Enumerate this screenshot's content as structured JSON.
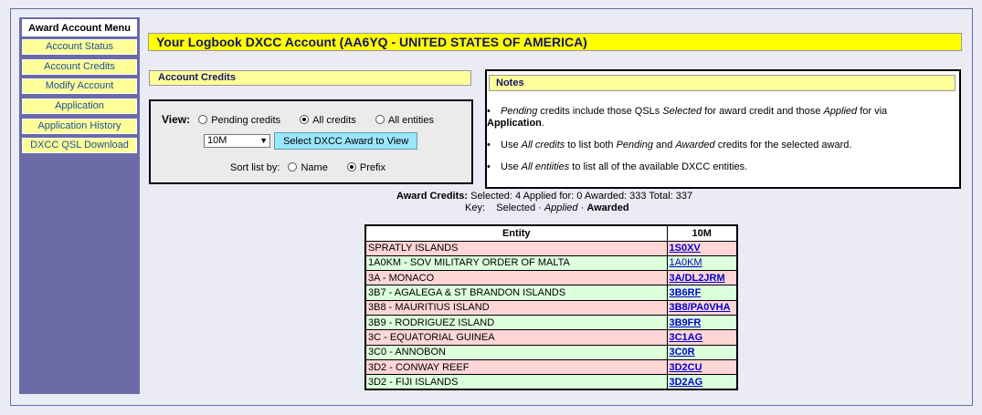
{
  "sidebar": {
    "header": "Award Account Menu",
    "items": [
      {
        "label": "Account Status"
      },
      {
        "label": "Account Credits"
      },
      {
        "label": "Modify Account"
      },
      {
        "label": "Application"
      },
      {
        "label": "Application History"
      },
      {
        "label": "DXCC QSL Download"
      }
    ]
  },
  "title": "Your Logbook DXCC Account (AA6YQ - UNITED STATES OF AMERICA)",
  "account_credits": {
    "header": "Account Credits",
    "view_label": "View:",
    "view_options": [
      "Pending credits",
      "All credits",
      "All entities"
    ],
    "view_selected": "All credits",
    "award_select_value": "10M",
    "select_button": "Select DXCC Award to View",
    "sort_label": "Sort list by:",
    "sort_options": [
      "Name",
      "Prefix"
    ],
    "sort_selected": "Prefix"
  },
  "notes": {
    "header": "Notes",
    "n1": {
      "a": "Pending",
      "b": " credits include those QSLs ",
      "c": "Selected",
      "d": " for award credit and those ",
      "e": "Applied",
      "f": " for via",
      "g": "Application",
      "h": "."
    },
    "n2": {
      "a": "Use ",
      "b": "All credits",
      "c": " to list both ",
      "d": "Pending",
      "e": " and ",
      "f": "Awarded",
      "g": " credits for the selected award."
    },
    "n3": {
      "a": "Use ",
      "b": "All entiities",
      "c": " to list all of the available DXCC entities."
    }
  },
  "summary": {
    "label": "Award Credits:",
    "text": " Selected: 4 Applied for: 0 Awarded: 333 Total: 337",
    "key_label": "Key:",
    "key_selected": "Selected",
    "sep": " · ",
    "key_applied": "Applied",
    "key_awarded": "Awarded"
  },
  "table": {
    "headers": [
      "Entity",
      "10M"
    ],
    "rows": [
      {
        "entity": "SPRATLY ISLANDS",
        "call": "1S0XV",
        "status": "pink"
      },
      {
        "entity": "1A0KM - SOV MILITARY ORDER OF MALTA",
        "call": "1A0KM",
        "status": "green"
      },
      {
        "entity": "3A - MONACO",
        "call": "3A/DL2JRM",
        "status": "pink"
      },
      {
        "entity": "3B7 - AGALEGA & ST BRANDON ISLANDS",
        "call": "3B6RF",
        "status": "green"
      },
      {
        "entity": "3B8 - MAURITIUS ISLAND",
        "call": "3B8/PA0VHA",
        "status": "pink"
      },
      {
        "entity": "3B9 - RODRIGUEZ ISLAND",
        "call": "3B9FR",
        "status": "green"
      },
      {
        "entity": "3C - EQUATORIAL GUINEA",
        "call": "3C1AG",
        "status": "pink"
      },
      {
        "entity": "3C0 - ANNOBON",
        "call": "3C0R",
        "status": "green"
      },
      {
        "entity": "3D2 - CONWAY REEF",
        "call": "3D2CU",
        "status": "pink"
      },
      {
        "entity": "3D2 - FIJI ISLANDS",
        "call": "3D2AG",
        "status": "green"
      }
    ]
  }
}
